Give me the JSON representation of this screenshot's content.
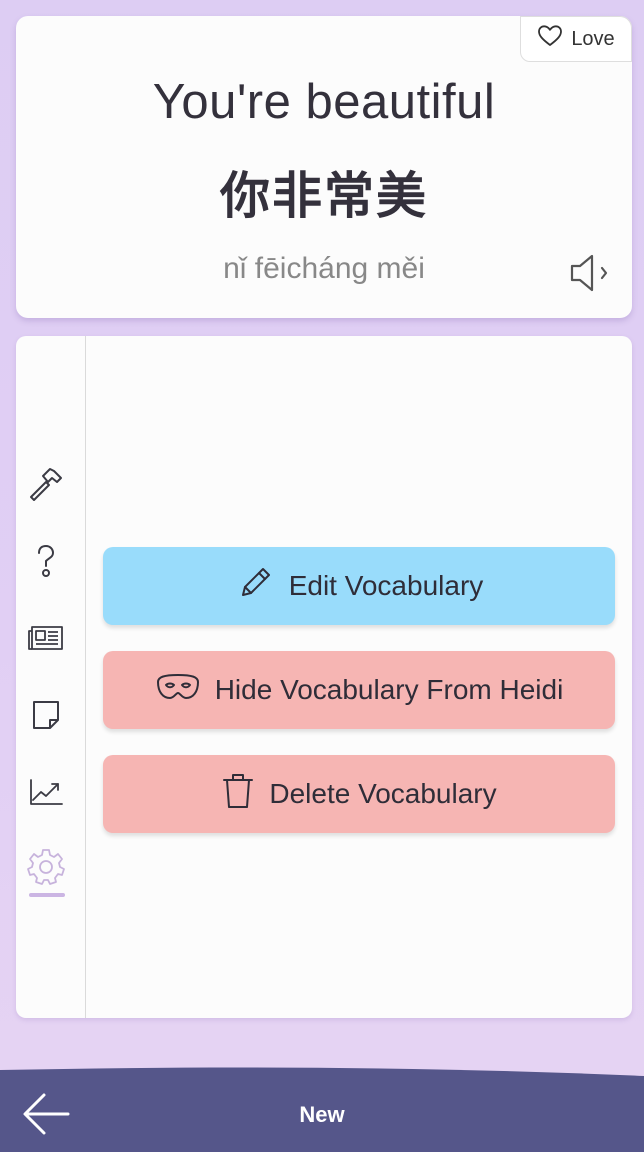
{
  "vocab_card": {
    "english": "You're beautiful",
    "hanzi": "你非常美",
    "pinyin": "nǐ fēicháng měi",
    "love_label": "Love"
  },
  "side_rail": {
    "icons": [
      "hammer-icon",
      "question-icon",
      "newspaper-icon",
      "sticky-note-icon",
      "chart-trend-icon",
      "settings-gear-icon"
    ],
    "active": "settings-gear-icon"
  },
  "actions": {
    "edit_label": "Edit Vocabulary",
    "hide_label": "Hide Vocabulary From Heidi",
    "delete_label": "Delete Vocabulary"
  },
  "bottom_bar": {
    "title": "New"
  },
  "colors": {
    "background": "#e1cff4",
    "edit_button": "#99dcfb",
    "danger_button": "#f6b5b3",
    "bottom_bar": "#55568a",
    "active_underline": "#cbb5e3"
  }
}
